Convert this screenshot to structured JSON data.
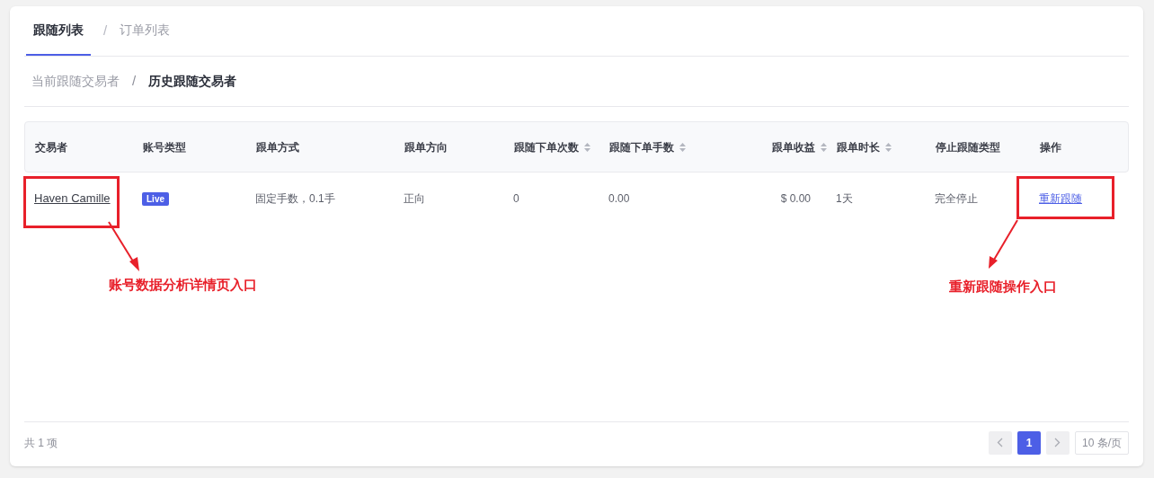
{
  "tabs": [
    {
      "label": "跟随列表",
      "selected": true
    },
    {
      "label": "订单列表",
      "selected": false
    }
  ],
  "tabs_separator": "/",
  "sub_tabs_separator": "/",
  "sub_tabs": [
    {
      "label": "当前跟随交易者",
      "selected": false
    },
    {
      "label": "历史跟随交易者",
      "selected": true
    }
  ],
  "table": {
    "columns": [
      {
        "label": "交易者",
        "sortable": false
      },
      {
        "label": "账号类型",
        "sortable": false
      },
      {
        "label": "跟单方式",
        "sortable": false
      },
      {
        "label": "跟单方向",
        "sortable": false
      },
      {
        "label": "跟随下单次数",
        "sortable": true
      },
      {
        "label": "跟随下单手数",
        "sortable": true
      },
      {
        "label": "跟单收益",
        "sortable": true
      },
      {
        "label": "跟单时长",
        "sortable": true
      },
      {
        "label": "停止跟随类型",
        "sortable": false
      },
      {
        "label": "操作",
        "sortable": false
      }
    ],
    "rows": [
      {
        "trader": "Haven Camille",
        "account_type": "Live",
        "mode": "固定手数，0.1手",
        "direction": "正向",
        "order_count": "0",
        "lots": "0.00",
        "profit": "$ 0.00",
        "duration": "1天",
        "stop_type": "完全停止",
        "action": "重新跟随"
      }
    ]
  },
  "annotations": [
    {
      "label": "账号数据分析详情页入口"
    },
    {
      "label": "重新跟随操作入口"
    }
  ],
  "footer": {
    "total": "共 1 项",
    "pages": [
      {
        "label": "1",
        "selected": true
      }
    ],
    "page_size": "10 条/页"
  }
}
